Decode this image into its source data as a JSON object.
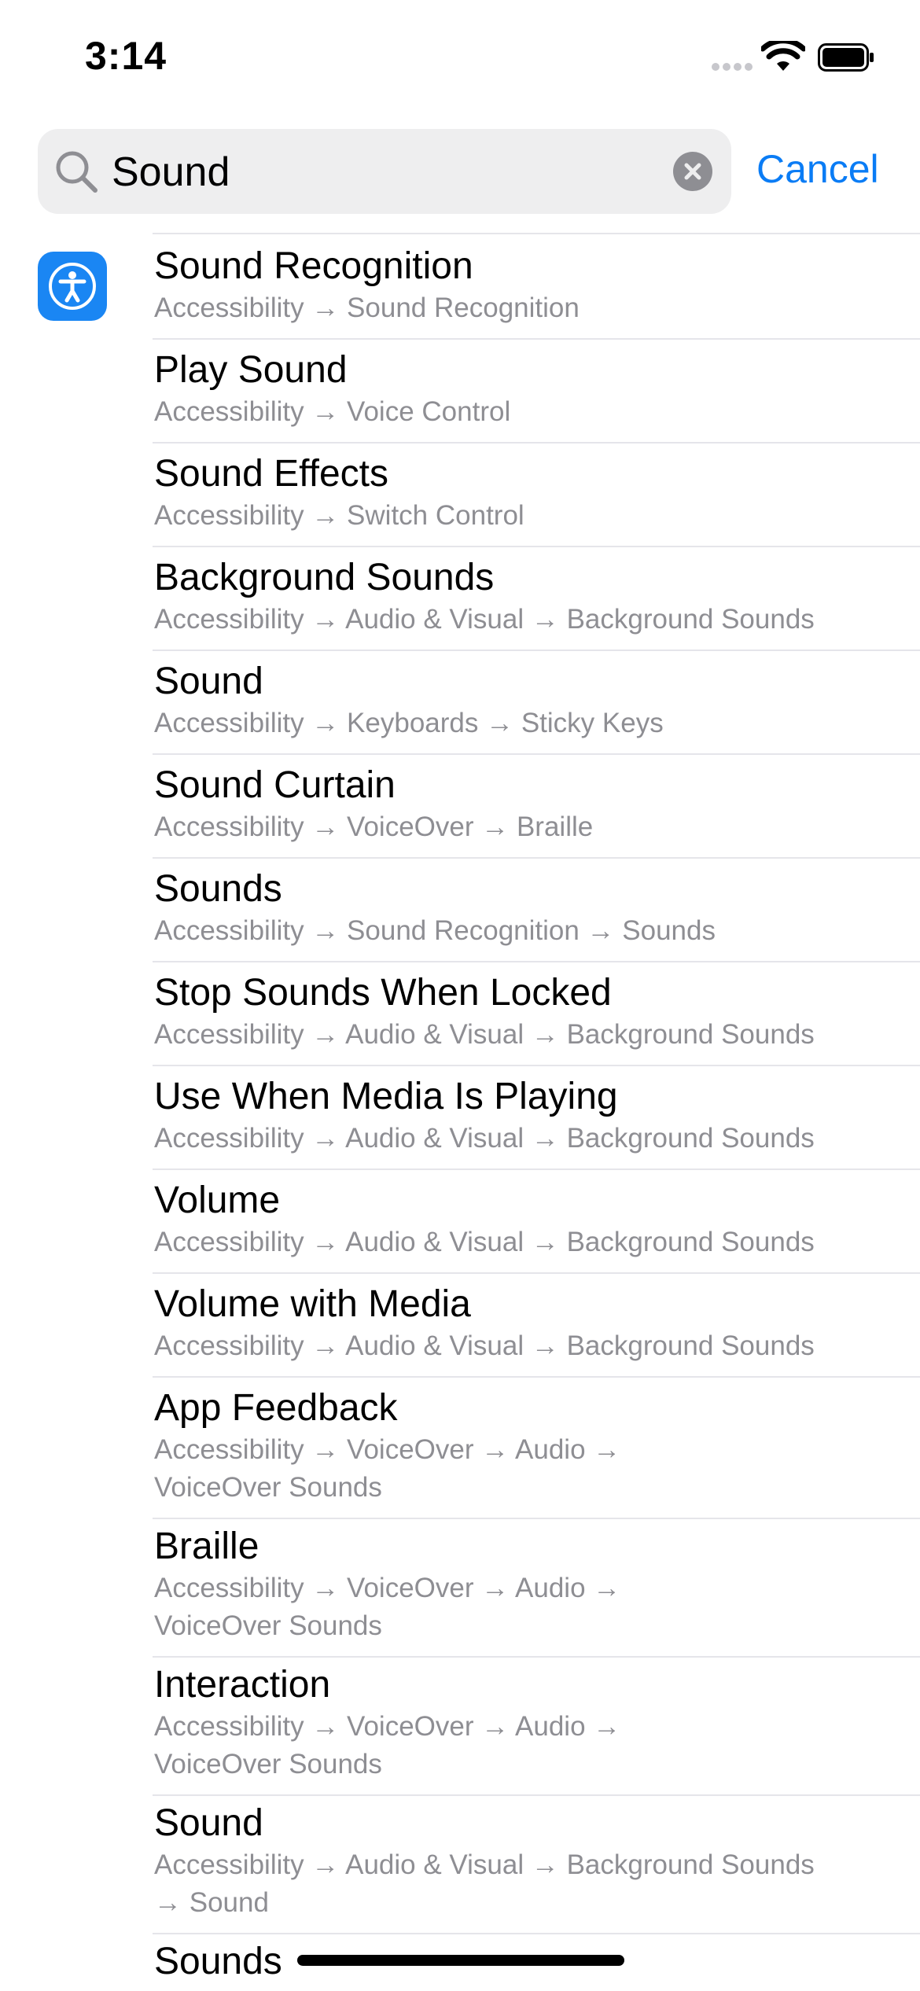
{
  "status": {
    "time": "3:14",
    "icons": [
      "signal-icon",
      "wifi-icon",
      "battery-icon"
    ]
  },
  "search": {
    "value": "Sound",
    "cancel_label": "Cancel"
  },
  "section": {
    "icon": "accessibility-icon",
    "icon_color": "#1a86f3"
  },
  "results": [
    {
      "title": "Sound Recognition",
      "path": "Accessibility → Sound Recognition"
    },
    {
      "title": "Play Sound",
      "path": "Accessibility → Voice Control"
    },
    {
      "title": "Sound Effects",
      "path": "Accessibility → Switch Control"
    },
    {
      "title": "Background Sounds",
      "path": "Accessibility → Audio & Visual → Background Sounds"
    },
    {
      "title": "Sound",
      "path": "Accessibility → Keyboards → Sticky Keys"
    },
    {
      "title": "Sound Curtain",
      "path": "Accessibility → VoiceOver → Braille"
    },
    {
      "title": "Sounds",
      "path": "Accessibility → Sound Recognition → Sounds"
    },
    {
      "title": "Stop Sounds When Locked",
      "path": "Accessibility → Audio & Visual → Background Sounds"
    },
    {
      "title": "Use When Media Is Playing",
      "path": "Accessibility → Audio & Visual → Background Sounds"
    },
    {
      "title": "Volume",
      "path": "Accessibility → Audio & Visual → Background Sounds"
    },
    {
      "title": "Volume with Media",
      "path": "Accessibility → Audio & Visual → Background Sounds"
    },
    {
      "title": "App Feedback",
      "path": "Accessibility → VoiceOver → Audio →",
      "path2": "VoiceOver Sounds"
    },
    {
      "title": "Braille",
      "path": "Accessibility → VoiceOver → Audio →",
      "path2": "VoiceOver Sounds"
    },
    {
      "title": "Interaction",
      "path": "Accessibility → VoiceOver → Audio →",
      "path2": "VoiceOver Sounds"
    },
    {
      "title": "Sound",
      "path": "Accessibility → Audio & Visual → Background Sounds",
      "path2": "→ Sound"
    },
    {
      "title": "Sounds"
    }
  ]
}
